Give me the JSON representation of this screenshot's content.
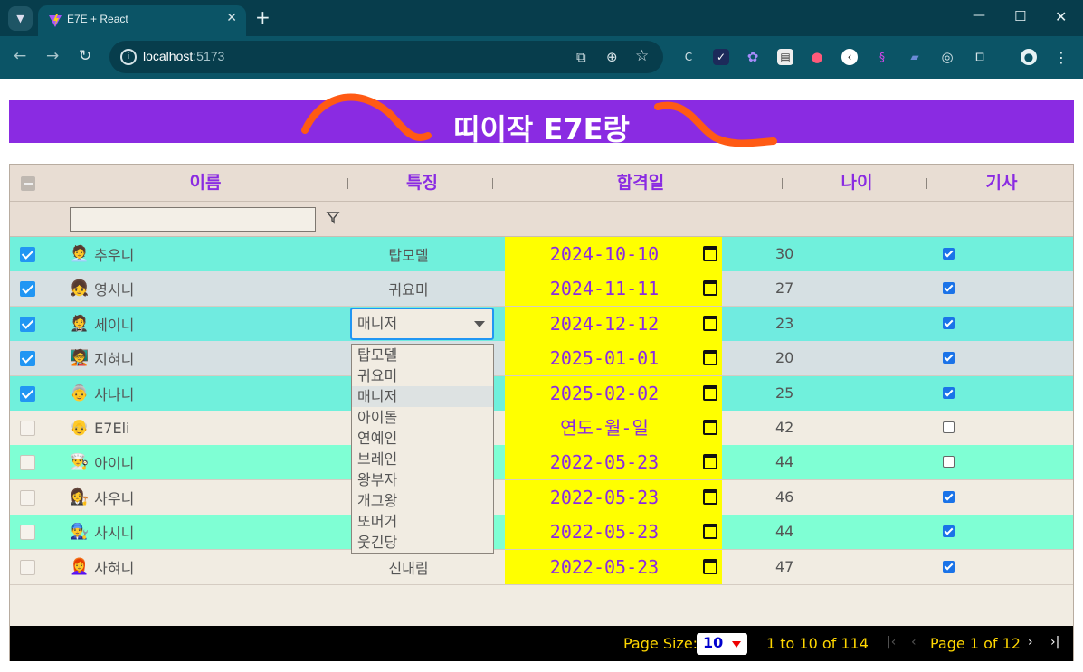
{
  "browser": {
    "tab_title": "E7E + React",
    "url_host": "localhost",
    "url_port": ":5173"
  },
  "page": {
    "banner_title": "띠이작 E7E랑",
    "accent_color": "#8a2be2",
    "banner_color": "#8a2be2"
  },
  "grid": {
    "columns": [
      "이름",
      "특징",
      "합격일",
      "나이",
      "기사"
    ],
    "filter_placeholder": "",
    "rows": [
      {
        "checked": true,
        "emoji": "🧑‍💼",
        "name": "추우니",
        "trait": "탑모델",
        "date": "2024-10-10",
        "age": "30",
        "kisa": true,
        "row_color": "#70f0dc"
      },
      {
        "checked": true,
        "emoji": "👧",
        "name": "영시니",
        "trait": "귀요미",
        "date": "2024-11-11",
        "age": "27",
        "kisa": true,
        "row_color": "#d6e0e3"
      },
      {
        "checked": true,
        "emoji": "🤵",
        "name": "세이니",
        "trait": "매니저",
        "date": "2024-12-12",
        "age": "23",
        "kisa": true,
        "row_color": "#70ebe0"
      },
      {
        "checked": true,
        "emoji": "🧑‍🏫",
        "name": "지혀니",
        "trait": "",
        "date": "2025-01-01",
        "age": "20",
        "kisa": true,
        "row_color": "#d6e0e3"
      },
      {
        "checked": true,
        "emoji": "👵",
        "name": "사나니",
        "trait": "",
        "date": "2025-02-02",
        "age": "25",
        "kisa": true,
        "row_color": "#70f0dc"
      },
      {
        "checked": false,
        "emoji": "👴",
        "name": "E7Eli",
        "trait": "",
        "date": "연도-월-일",
        "age": "42",
        "kisa": false,
        "row_color": "#f1ece2"
      },
      {
        "checked": false,
        "emoji": "👨‍🍳",
        "name": "아이니",
        "trait": "",
        "date": "2022-05-23",
        "age": "44",
        "kisa": false,
        "row_color": "#7fffd4"
      },
      {
        "checked": false,
        "emoji": "👩‍⚖️",
        "name": "사우니",
        "trait": "",
        "date": "2022-05-23",
        "age": "46",
        "kisa": true,
        "row_color": "#f1ece2"
      },
      {
        "checked": false,
        "emoji": "👨‍🔧",
        "name": "사시니",
        "trait": "",
        "date": "2022-05-23",
        "age": "44",
        "kisa": true,
        "row_color": "#7fffd4"
      },
      {
        "checked": false,
        "emoji": "👩‍🦰",
        "name": "사혀니",
        "trait": "신내림",
        "date": "2022-05-23",
        "age": "47",
        "kisa": true,
        "row_color": "#f1ece2"
      }
    ],
    "editing_select_value": "매니저",
    "dropdown_options": [
      "탑모델",
      "귀요미",
      "매니저",
      "아이돌",
      "연예인",
      "브레인",
      "왕부자",
      "개그왕",
      "또머거",
      "웃긴당"
    ],
    "dropdown_selected": "매니저"
  },
  "paging": {
    "page_size_label": "Page Size:",
    "page_size_value": "10",
    "range_text": "1 to 10 of 114",
    "page_text": "Page 1 of 12"
  }
}
